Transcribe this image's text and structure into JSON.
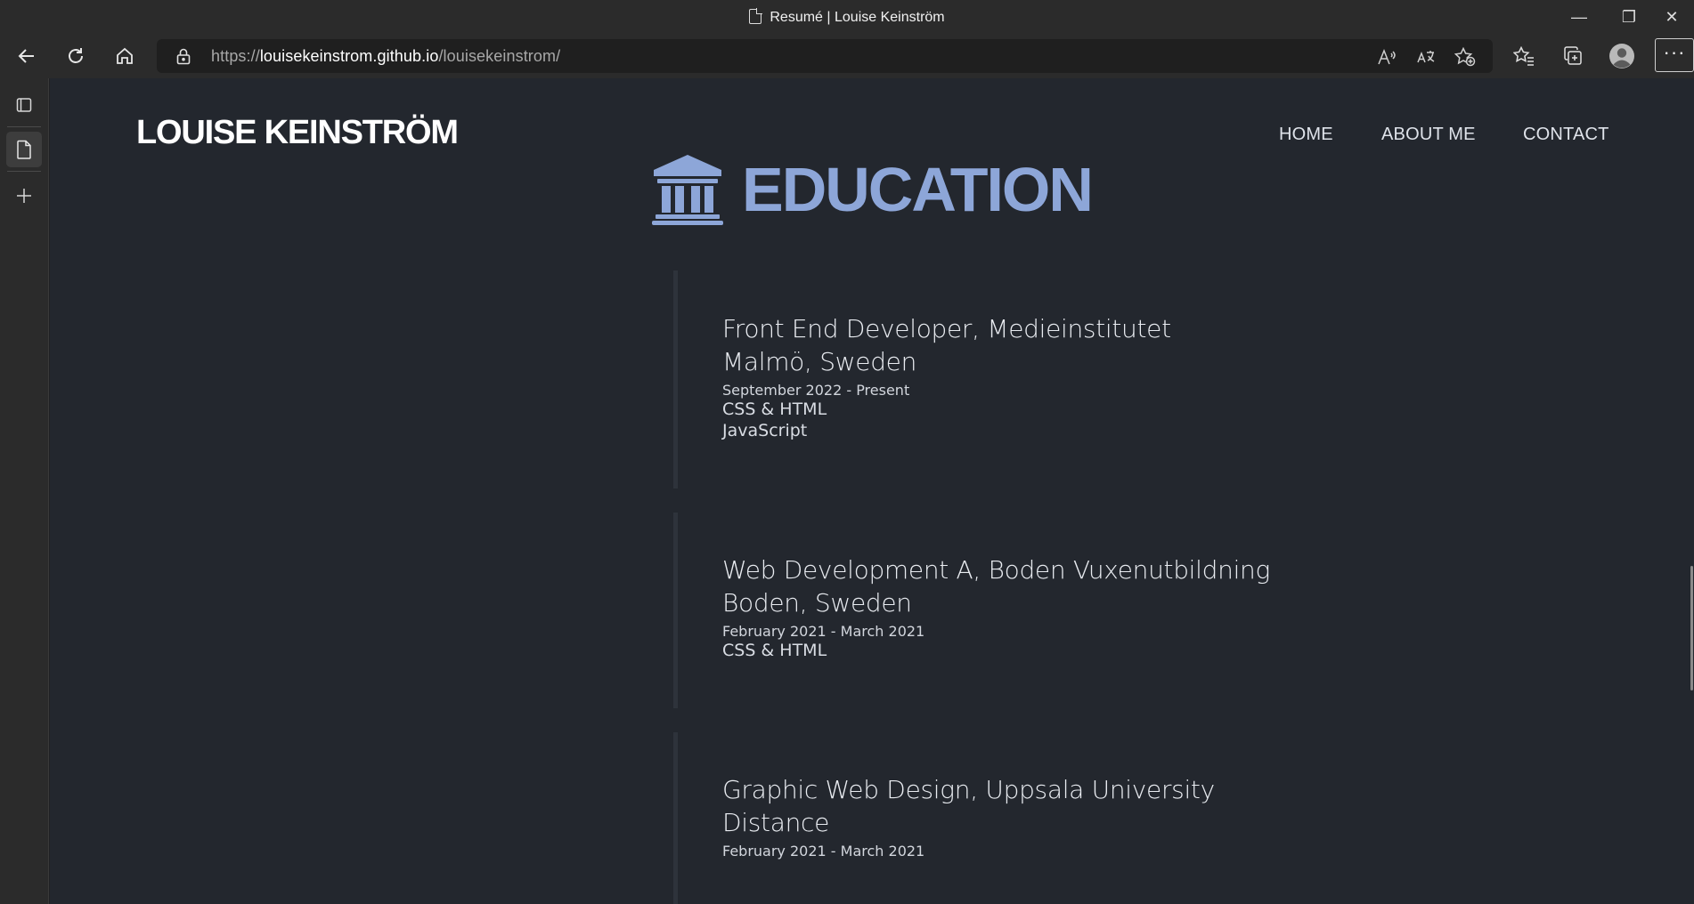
{
  "browser": {
    "tab_title": "Resumé | Louise Keinström",
    "url_scheme": "https://",
    "url_host": "louisekeinstrom.github.io",
    "url_path": "/louisekeinstrom/",
    "icons": {
      "back": "back-arrow-icon",
      "refresh": "refresh-icon",
      "home": "home-icon",
      "lock": "lock-icon",
      "read_aloud": "read-aloud-icon",
      "translate": "translate-icon",
      "add_favorite": "add-favorite-icon",
      "favorites": "favorites-icon",
      "collections": "collections-icon",
      "profile": "profile-icon",
      "more": "more-icon"
    },
    "window_controls": {
      "minimize": "—",
      "restore": "❐",
      "close": "✕"
    },
    "more_label": "···"
  },
  "site": {
    "brand": "LOUISE KEINSTRÖM",
    "nav": [
      {
        "label": "HOME"
      },
      {
        "label": "ABOUT ME"
      },
      {
        "label": "CONTACT"
      }
    ],
    "section_title": "EDUCATION",
    "section_icon": "university-building-icon",
    "accent_color": "#8da6d8",
    "background_color": "#23272e"
  },
  "education": [
    {
      "title_line1": "Front End Developer, Medieinstitutet",
      "title_line2": "Malmö, Sweden",
      "dates": "September 2022 - Present",
      "subjects": [
        "CSS & HTML",
        "JavaScript"
      ]
    },
    {
      "title_line1": "Web Development A, Boden Vuxenutbildning",
      "title_line2": "Boden, Sweden",
      "dates": "February 2021 - March 2021",
      "subjects": [
        "CSS & HTML"
      ]
    },
    {
      "title_line1": "Graphic Web Design, Uppsala University",
      "title_line2": "Distance",
      "dates": "February 2021 - March 2021",
      "subjects": []
    }
  ]
}
